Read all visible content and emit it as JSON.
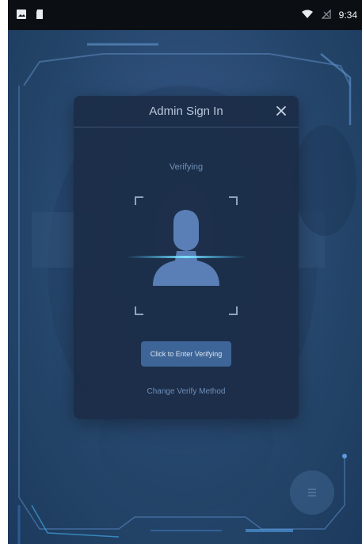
{
  "status_bar": {
    "time": "9:34",
    "left_icons": [
      "image-icon",
      "sd-card-icon"
    ],
    "right_icons": [
      "wifi-icon",
      "no-signal-icon"
    ]
  },
  "dialog": {
    "title": "Admin Sign In",
    "status": "Verifying",
    "enter_button_label": "Click to Enter Verifying",
    "change_method_label": "Change Verify Method"
  },
  "colors": {
    "background": "#2e4f7a",
    "dialog": "#1b2c47",
    "accent": "#3e6597",
    "scan_line": "#3fc7ff"
  },
  "icons": {
    "close": "close-icon",
    "avatar": "user-silhouette-icon",
    "menu": "menu-icon"
  }
}
